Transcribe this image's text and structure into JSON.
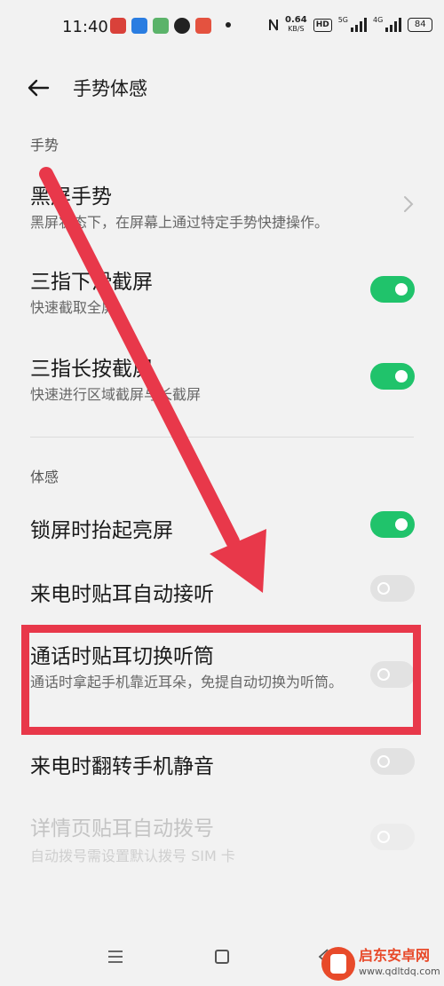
{
  "status_bar": {
    "time": "11:40",
    "net_speed_value": "0.64",
    "net_speed_unit": "KB/S",
    "hd_badge": "HD",
    "sim1_label": "5G",
    "sim2_label": "4G",
    "battery_level": "84"
  },
  "header": {
    "title": "手势体感"
  },
  "sections": {
    "gesture_label": "手势",
    "motion_label": "体感"
  },
  "gesture_items": [
    {
      "title": "黑屏手势",
      "subtitle": "黑屏状态下，在屏幕上通过特定手势快捷操作。"
    },
    {
      "title": "三指下滑截屏",
      "subtitle": "快速截取全屏",
      "on": true
    },
    {
      "title": "三指长按截屏",
      "subtitle": "快速进行区域截屏与长截屏",
      "on": true
    }
  ],
  "motion_items": [
    {
      "title": "锁屏时抬起亮屏",
      "on": true
    },
    {
      "title": "来电时贴耳自动接听",
      "on": false
    },
    {
      "title": "通话时贴耳切换听筒",
      "subtitle": "通话时拿起手机靠近耳朵，免提自动切换为听筒。",
      "on": false
    },
    {
      "title": "来电时翻转手机静音",
      "on": false
    },
    {
      "title": "详情页贴耳自动拨号",
      "subtitle": "自动拨号需设置默认拨号 SIM 卡",
      "on": false,
      "disabled": true
    }
  ],
  "watermark": {
    "name": "启东安卓网",
    "url": "www.qdltdq.com"
  },
  "colors": {
    "toggle_on": "#20c36b",
    "annotation_red": "#e8384a",
    "background": "#f2f2f2"
  }
}
